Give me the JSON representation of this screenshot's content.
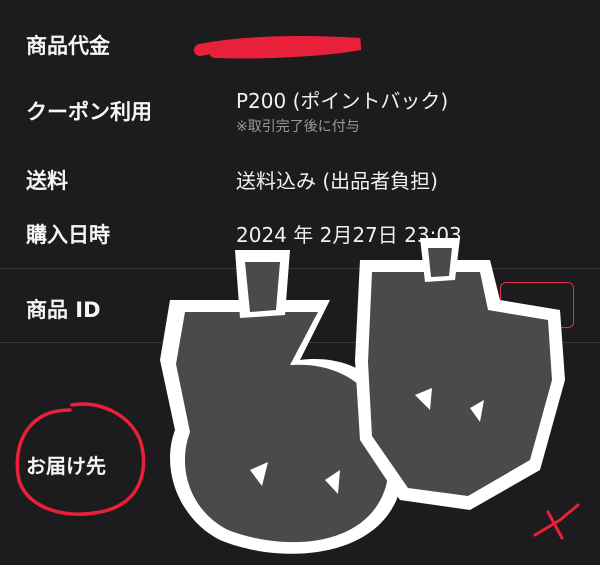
{
  "rows": {
    "price": {
      "label": "商品代金",
      "value": ""
    },
    "coupon": {
      "label": "クーポン利用",
      "value": "P200 (ポイントバック)",
      "note": "※取引完了後に付与"
    },
    "shipping": {
      "label": "送料",
      "value": "送料込み (出品者負担)"
    },
    "purchase": {
      "label": "購入日時",
      "value": "2024 年 2月27日 23:03"
    },
    "item_id": {
      "label": "商品 ID",
      "value": ""
    },
    "delivery": {
      "label": "お届け先"
    }
  },
  "colors": {
    "background": "#1c1c1e",
    "divider": "#3a3a3c",
    "redaction_red": "#e8203a",
    "sticker_fill": "#4a4a4a",
    "sticker_outline": "#ffffff"
  }
}
